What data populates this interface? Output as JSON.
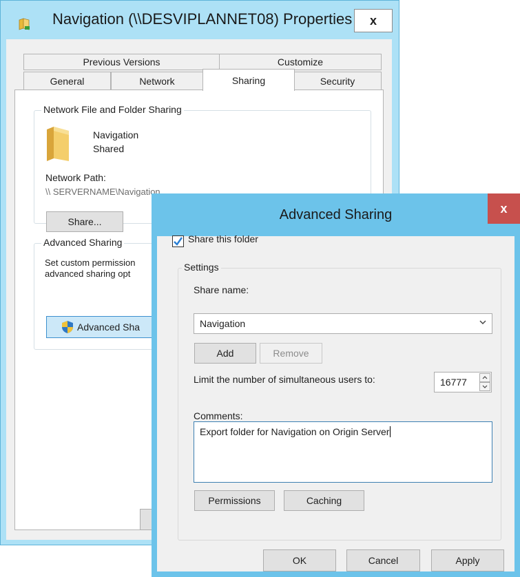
{
  "properties_window": {
    "title": "Navigation (\\\\DESVIPLANNET08) Properties",
    "close_glyph": "x",
    "tabs_row1": [
      "Previous Versions",
      "Customize"
    ],
    "tabs_row2": [
      "General",
      "Network",
      "Sharing",
      "Security"
    ],
    "active_tab": "Sharing",
    "network_group": {
      "label": "Network File and Folder Sharing",
      "folder_name": "Navigation",
      "folder_status": "Shared",
      "network_path_label": "Network Path:",
      "network_path_value": "\\\\ SERVERNAME\\Navigation",
      "share_button": "Share..."
    },
    "advanced_group": {
      "label": "Advanced Sharing",
      "description_line1": "Set custom permission",
      "description_line2": "advanced sharing opt",
      "advanced_button": "Advanced Sha"
    }
  },
  "advanced_sharing_dialog": {
    "title": "Advanced Sharing",
    "close_glyph": "x",
    "share_checkbox_label": "Share this folder",
    "share_checked": true,
    "settings_label": "Settings",
    "share_name_label": "Share name:",
    "share_name_value": "Navigation",
    "add_button": "Add",
    "remove_button": "Remove",
    "limit_label": "Limit the number of simultaneous users to:",
    "limit_value": "16777",
    "comments_label": "Comments:",
    "comments_value": "Export folder for Navigation on Origin Server",
    "permissions_button": "Permissions",
    "caching_button": "Caching",
    "ok_button": "OK",
    "cancel_button": "Cancel",
    "apply_button": "Apply"
  },
  "colors": {
    "title_bar_properties": "#ade1f6",
    "title_bar_advanced": "#6cc3ea",
    "close_red": "#c7504d",
    "checkbox_accent": "#2a7fd4"
  }
}
